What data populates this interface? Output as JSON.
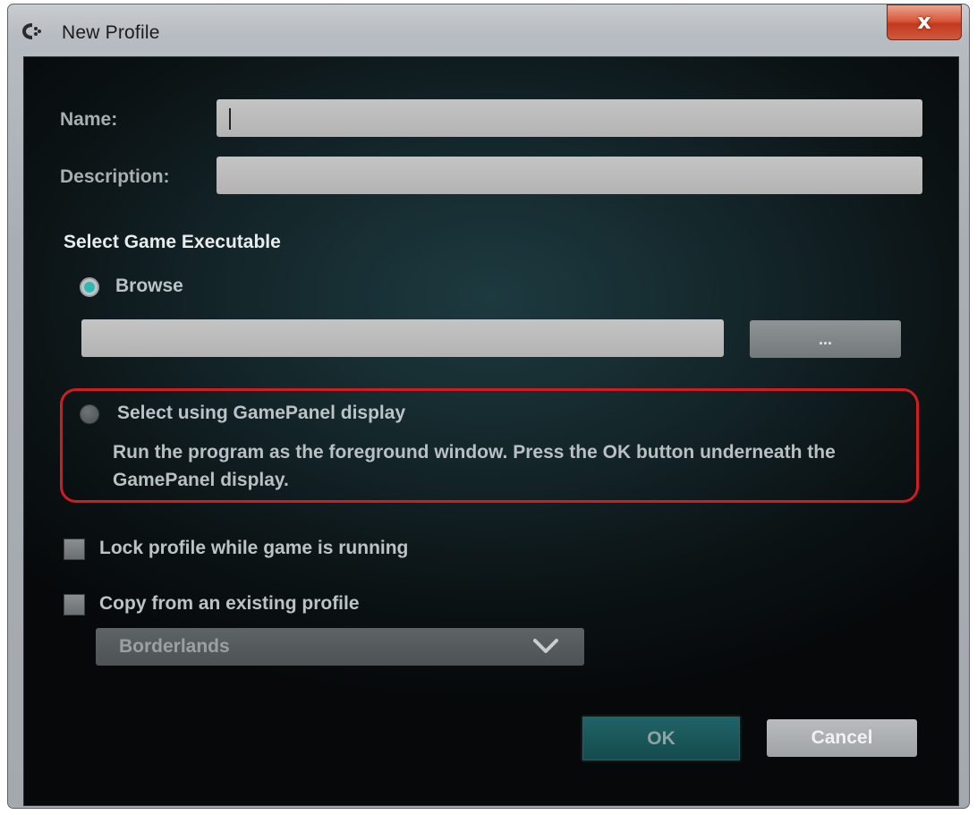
{
  "window": {
    "title": "New Profile",
    "close_icon": "close-x-icon",
    "close_label": "x"
  },
  "form": {
    "name_label": "Name:",
    "name_value": "",
    "description_label": "Description:",
    "description_value": ""
  },
  "executable": {
    "section_title": "Select Game Executable",
    "browse_option_label": "Browse",
    "browse_selected": true,
    "path_value": "",
    "browse_button_label": "...",
    "gamepanel_option_label": "Select using GamePanel display",
    "gamepanel_selected": false,
    "gamepanel_description": "Run the program as the foreground window. Press the OK button underneath the GamePanel display."
  },
  "options": {
    "lock_label": "Lock profile while game is running",
    "lock_checked": false,
    "copy_label": "Copy from an existing profile",
    "copy_checked": false,
    "profile_selected": "Borderlands"
  },
  "buttons": {
    "ok_label": "OK",
    "cancel_label": "Cancel"
  },
  "colors": {
    "accent_teal": "#2fb9b6",
    "highlight_red": "#d21b22"
  }
}
